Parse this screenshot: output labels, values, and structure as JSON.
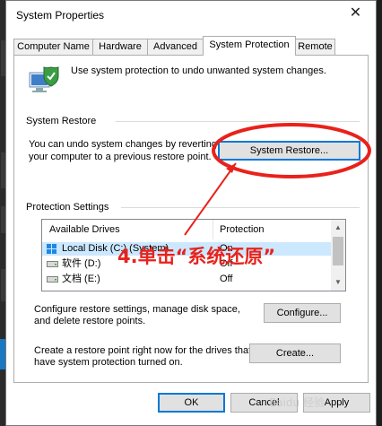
{
  "window": {
    "title": "System Properties"
  },
  "tabs": [
    {
      "label": "Computer Name"
    },
    {
      "label": "Hardware"
    },
    {
      "label": "Advanced"
    },
    {
      "label": "System Protection"
    },
    {
      "label": "Remote"
    }
  ],
  "intro": {
    "text": "Use system protection to undo unwanted system changes."
  },
  "restore": {
    "heading": "System Restore",
    "desc_line1": "You can undo system changes by reverting",
    "desc_line2": "your computer to a previous restore point.",
    "button": "System Restore..."
  },
  "protection": {
    "heading": "Protection Settings",
    "col_drives": "Available Drives",
    "col_protection": "Protection",
    "drives": [
      {
        "name": "Local Disk (C:) (System)",
        "protection": "On"
      },
      {
        "name": "软件 (D:)",
        "protection": "Off"
      },
      {
        "name": "文档 (E:)",
        "protection": "Off"
      }
    ]
  },
  "configure": {
    "line1": "Configure restore settings, manage disk space,",
    "line2": "and delete restore points.",
    "button": "Configure..."
  },
  "create": {
    "line1": "Create a restore point right now for the drives that",
    "line2": "have system protection turned on.",
    "button": "Create..."
  },
  "footer": {
    "ok": "OK",
    "cancel": "Cancel",
    "apply": "Apply"
  },
  "annotation": {
    "text": "4.单击“系统还原”",
    "color": "#e8221b"
  },
  "watermark": {
    "text": "Baidu 经验"
  }
}
